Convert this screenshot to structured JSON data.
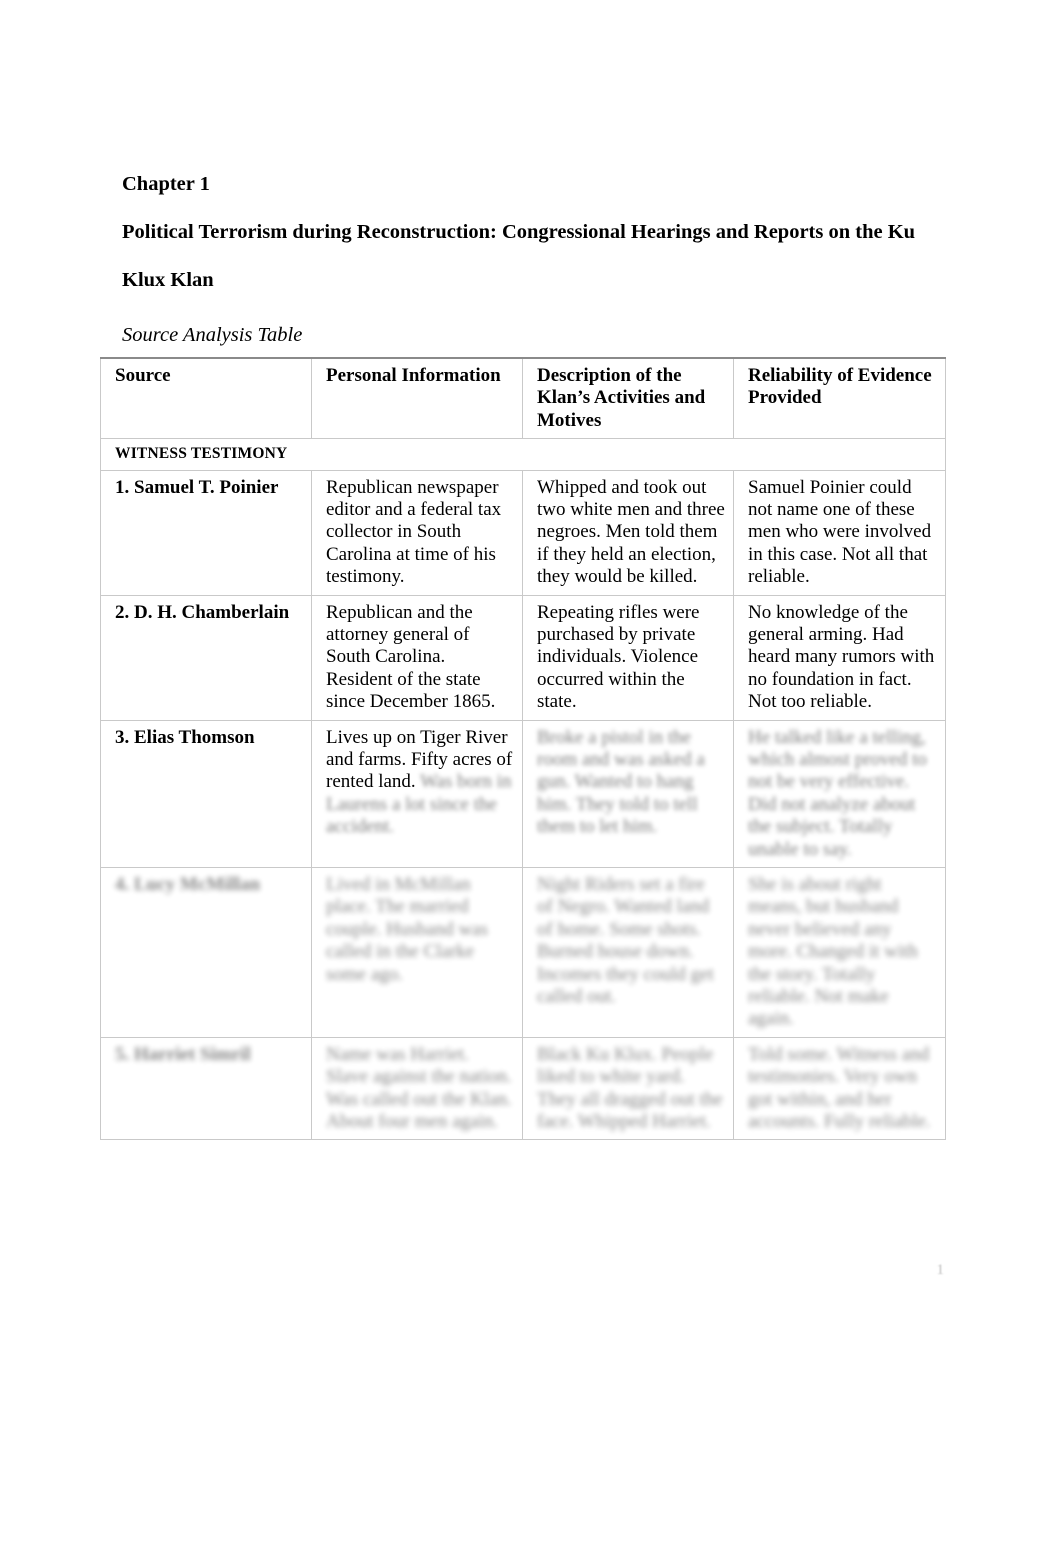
{
  "document": {
    "chapter_label": "Chapter 1",
    "title": "Political Terrorism during Reconstruction: Congressional Hearings and Reports on the Ku Klux Klan",
    "title_line1": "Political Terrorism during Reconstruction: Congressional Hearings and Reports on the Ku",
    "title_line2": "Klux Klan",
    "subtitle": "Source Analysis Table",
    "page_number": "1"
  },
  "table": {
    "columns": [
      "Source",
      "Personal Information",
      "Description of the Klan’s Activities and Motives",
      "Reliability of Evidence Provided"
    ],
    "section_heading": "WITNESS TESTIMONY",
    "rows": [
      {
        "source": "1. Samuel T. Poinier",
        "personal_information": "Republican newspaper editor and a federal tax collector in South Carolina at time of his testimony.",
        "klan_activities": "Whipped and took out two white men and three negroes. Men told them if they held an election, they would be killed.",
        "reliability": "Samuel Poinier could not name one of these men who were involved in this case. Not all that reliable."
      },
      {
        "source": "2. D. H. Chamberlain",
        "personal_information": "Republican and the attorney general of South Carolina. Resident of the state since December 1865.",
        "klan_activities": "Repeating rifles were purchased by private individuals. Violence occurred within the state.",
        "reliability": "No knowledge of the general arming. Had heard many rumors with no foundation in fact. Not too reliable."
      },
      {
        "source": "3. Elias Thomson",
        "personal_information": "Lives up on Tiger River and farms. Fifty acres of rented land. Was born in Laurens a lot since the accident.",
        "klan_activities": "Broke a pistol in the room and was asked a gun. Wanted to hang him. They told to tell them to let him.",
        "reliability": "He talked like a telling, which almost proved to not be very effective. Did not analyze about the subject. Totally unable to say."
      },
      {
        "source": "4. Lucy McMillan",
        "personal_information": "Lived in McMillan place. The married couple. Husband was called in the Clarke some ago.",
        "klan_activities": "Night Riders set a fire of Negro. Wanted land of home. Some shots. Burned house down. Incomes they could get called out.",
        "reliability": "She is about right means, but husband never believed any more. Changed it with the story. Totally reliable. Not make again."
      },
      {
        "source": "5. Harriet Simril",
        "personal_information": "Name was Harriet. Slave against the nation. Was called out the Klan. About four men again.",
        "klan_activities": "Black Ku Klux. People liked to white yard. They all dragged out the face. Whipped Harriet.",
        "reliability": "Told some. Witness and testimonies. Very own got within, and her accounts. Fully reliable."
      }
    ]
  }
}
